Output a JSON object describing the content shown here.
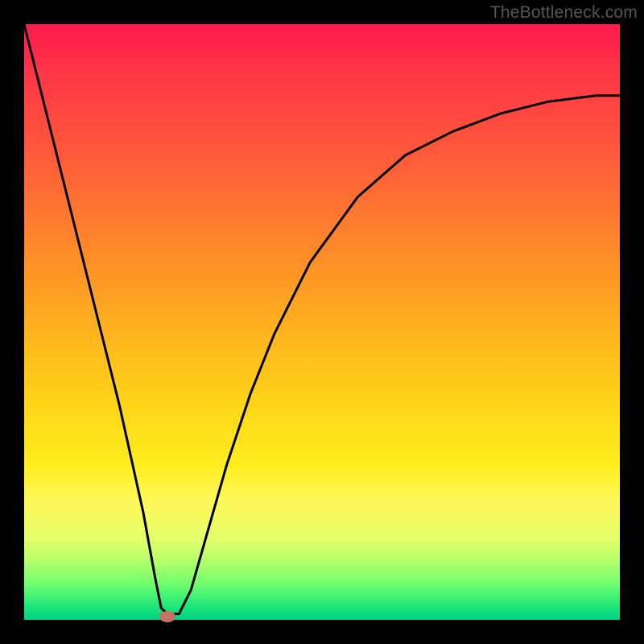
{
  "watermark": "TheBottleneck.com",
  "colors": {
    "frame": "#000000",
    "curve": "#000000",
    "marker": "#c77062",
    "gradient_stops": [
      "#ff1a4d",
      "#ff3547",
      "#ff5a3a",
      "#ff8a2a",
      "#ffb41e",
      "#ffd519",
      "#ffee1e",
      "#fff85a",
      "#e8ff6a",
      "#b6ff6a",
      "#6fff6f",
      "#19e57a",
      "#00d084"
    ]
  },
  "chart_data": {
    "type": "line",
    "title": "",
    "xlabel": "",
    "ylabel": "",
    "xlim": [
      0,
      100
    ],
    "ylim": [
      0,
      100
    ],
    "grid": false,
    "legend": false,
    "series": [
      {
        "name": "bottleneck-curve",
        "x": [
          0,
          4,
          8,
          12,
          16,
          20,
          22,
          23,
          24,
          26,
          28,
          30,
          34,
          38,
          42,
          48,
          56,
          64,
          72,
          80,
          88,
          96,
          100
        ],
        "y": [
          100,
          84,
          68,
          52,
          36,
          18,
          7,
          2,
          1,
          1,
          5,
          12,
          26,
          38,
          48,
          60,
          71,
          78,
          82,
          85,
          87,
          88,
          88
        ]
      }
    ],
    "marker": {
      "x": 24,
      "y": 0.5
    },
    "note": "x/y are relative to plot area; y=0 is bottom (green), y=100 is top (red). Values estimated from pixels."
  }
}
